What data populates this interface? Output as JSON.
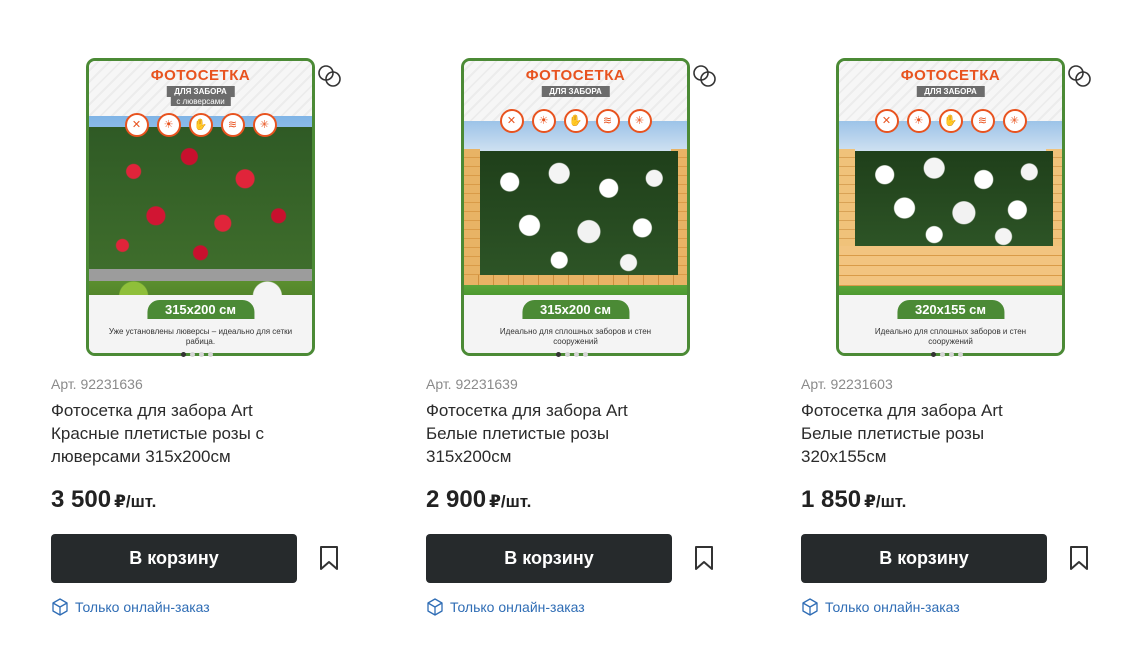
{
  "colors": {
    "accent_dark": "#262a2c",
    "link_blue": "#2f6db5",
    "border_green": "#4b8a35",
    "banner_orange": "#e8531f"
  },
  "products": [
    {
      "image": {
        "headline": "ФОТОСЕТКА",
        "subline": "ДЛЯ ЗАБОРА",
        "subline2": "с люверсами",
        "size_badge": "315х200 см",
        "note": "Уже установлены люверсы – идеально для сетки рабица.",
        "style": "red-roses"
      },
      "carousel": {
        "count": 4,
        "active": 1
      },
      "sku": "Арт. 92231636",
      "title": "Фотосетка для забора Art Красные плетистые розы с люверсами 315х200см",
      "price": "3 500",
      "unit": "₽/шт.",
      "cart_label": "В корзину",
      "availability": "Только онлайн-заказ",
      "icons": {
        "compare": "compare-icon",
        "favorite": "bookmark-icon",
        "delivery": "box-icon"
      }
    },
    {
      "image": {
        "headline": "ФОТОСЕТКА",
        "subline": "ДЛЯ ЗАБОРА",
        "subline2": "",
        "size_badge": "315х200 см",
        "note": "Идеально для сплошных заборов и стен сооружений",
        "style": "white-roses"
      },
      "carousel": {
        "count": 4,
        "active": 1
      },
      "sku": "Арт. 92231639",
      "title": "Фотосетка для забора Art Белые плетистые розы 315х200см",
      "price": "2 900",
      "unit": "₽/шт.",
      "cart_label": "В корзину",
      "availability": "Только онлайн-заказ",
      "icons": {
        "compare": "compare-icon",
        "favorite": "bookmark-icon",
        "delivery": "box-icon"
      }
    },
    {
      "image": {
        "headline": "ФОТОСЕТКА",
        "subline": "ДЛЯ ЗАБОРА",
        "subline2": "",
        "size_badge": "320х155 см",
        "note": "Идеально для сплошных заборов и стен сооружений",
        "style": "white-roses-brick"
      },
      "carousel": {
        "count": 4,
        "active": 1
      },
      "sku": "Арт. 92231603",
      "title": "Фотосетка для забора Art Белые плетистые розы 320х155см",
      "price": "1 850",
      "unit": "₽/шт.",
      "cart_label": "В корзину",
      "availability": "Только онлайн-заказ",
      "icons": {
        "compare": "compare-icon",
        "favorite": "bookmark-icon",
        "delivery": "box-icon"
      }
    }
  ]
}
